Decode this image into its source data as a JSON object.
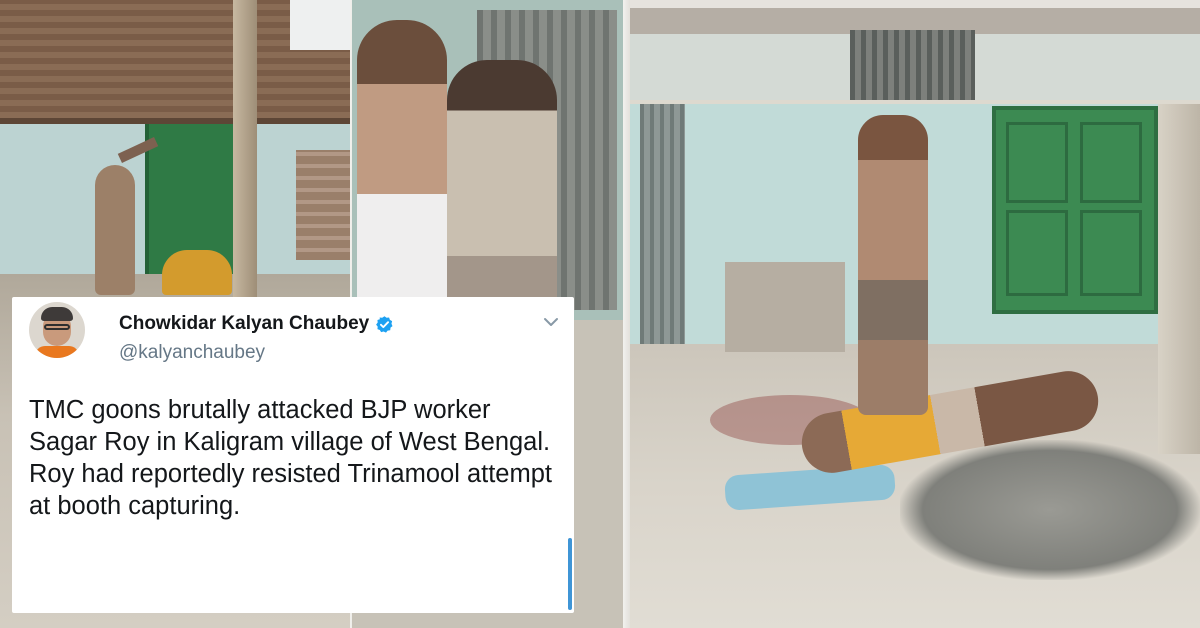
{
  "tweet": {
    "display_name": "Chowkidar Kalyan Chaubey",
    "handle": "@kalyanchaubey",
    "text": "TMC goons brutally attacked BJP worker Sagar Roy in Kaligram village of West Bengal. Roy had reportedly resisted Trinamool attempt at booth capturing.",
    "verified": true,
    "icons": {
      "verified": "verified-badge-icon",
      "more": "chevron-down-icon",
      "avatar": "profile-photo"
    },
    "colors": {
      "name": "#14171a",
      "handle": "#657786",
      "verified": "#1da1f2",
      "accent": "#3f95d6"
    }
  },
  "photos": [
    "left-photo-attack-scene",
    "middle-photo-two-men",
    "right-photo-assault-scene"
  ]
}
